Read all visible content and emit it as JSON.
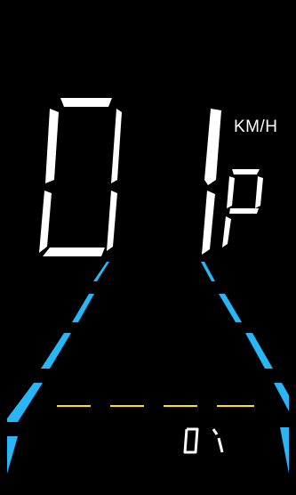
{
  "speed": {
    "value": "01",
    "unit": "KM/H"
  },
  "gear": {
    "mode": "P"
  },
  "trip": {
    "value": "01"
  },
  "lane": {
    "color": "#29b6f6",
    "divider_color": "#ffe600"
  },
  "colors": {
    "digits": "#ffffff",
    "background": "#000000"
  }
}
